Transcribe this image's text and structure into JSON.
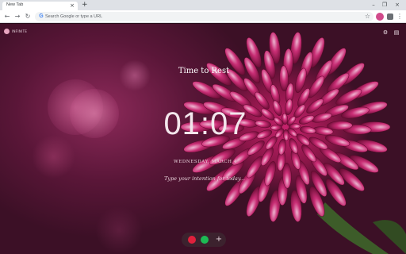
{
  "browser": {
    "tab_title": "New Tab",
    "tab_close": "×",
    "new_tab": "+",
    "minimize": "–",
    "maximize": "❐",
    "close": "×",
    "back": "←",
    "forward": "→",
    "reload": "↻",
    "search_placeholder": "Search Google or type a URL",
    "google_logo": "G",
    "bookmark_star": "☆",
    "menu": "⋮"
  },
  "app": {
    "brand": "INFINITE",
    "settings_icon": "⚙",
    "gallery_icon": "▤",
    "headline": "Time to Rest",
    "clock": "01:07",
    "date": "WEDNESDAY, MARCH 4",
    "intention_placeholder": "Type your intention for today...",
    "dock_add": "+"
  },
  "colors": {
    "accent_pink": "#c6226c",
    "dock_red": "#e0203c",
    "dock_green": "#1db954",
    "ext_avatar": "#d14a8b",
    "ext_puzzle": "#5f6368"
  }
}
